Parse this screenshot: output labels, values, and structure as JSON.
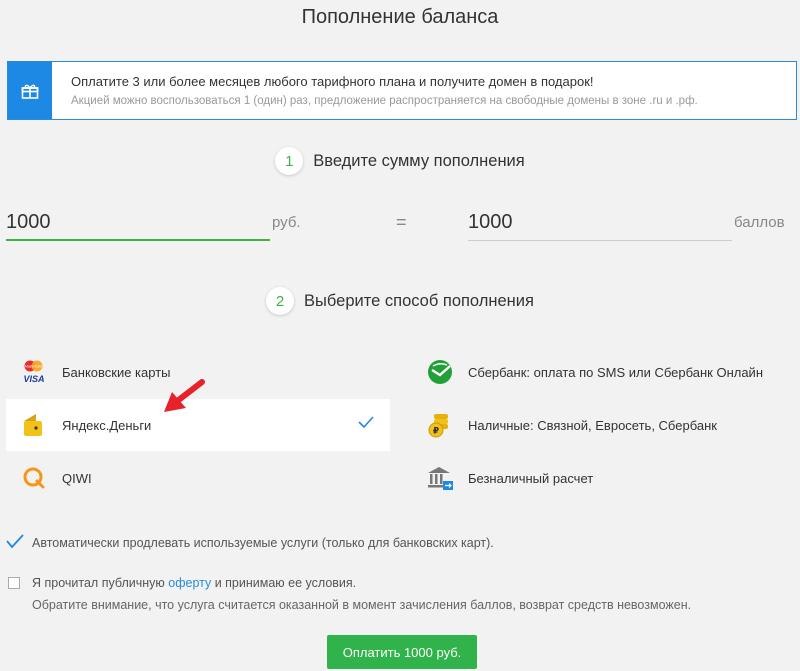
{
  "page": {
    "title": "Пополнение баланса"
  },
  "promo": {
    "line1": "Оплатите 3 или более месяцев любого тарифного плана и получите домен в подарок!",
    "line2": "Акцией можно воспользоваться 1 (один) раз, предложение распространяется на свободные домены в зоне .ru и .рф."
  },
  "step1": {
    "number": "1",
    "label": "Введите сумму пополнения"
  },
  "amount": {
    "value": "1000",
    "unit": "руб.",
    "equals": "=",
    "points_value": "1000",
    "points_unit": "баллов"
  },
  "step2": {
    "number": "2",
    "label": "Выберите способ пополнения"
  },
  "methods": {
    "cards": "Банковские карты",
    "yandex": "Яндекс.Деньги",
    "qiwi": "QIWI",
    "sberbank": "Сбербанк: оплата по SMS или Сбербанк Онлайн",
    "cash": "Наличные: Связной, Евросеть, Сбербанк",
    "bank_transfer": "Безналичный расчет",
    "visa_text": "VISA",
    "mc_text": "MasterCard",
    "cash_symbol": "₽"
  },
  "auto_renew": {
    "label": "Автоматически продлевать используемые услуги (только для банковских карт)."
  },
  "terms": {
    "prefix": "Я прочитал публичную ",
    "link": "оферту",
    "suffix": " и принимаю ее условия.",
    "note": "Обратите внимание, что услуга считается оказанной в момент зачисления баллов, возврат средств невозможен."
  },
  "pay_button": {
    "label": "Оплатить 1000 руб."
  },
  "colors": {
    "accent_green": "#2fb34a",
    "accent_blue": "#1e88e5",
    "link_blue": "#2a8bd8"
  },
  "icons": [
    "gift-icon",
    "mastercard-visa-icon",
    "yandex-money-icon",
    "qiwi-icon",
    "sberbank-icon",
    "cash-coins-icon",
    "bank-building-icon",
    "checkmark-icon",
    "red-arrow-icon"
  ]
}
